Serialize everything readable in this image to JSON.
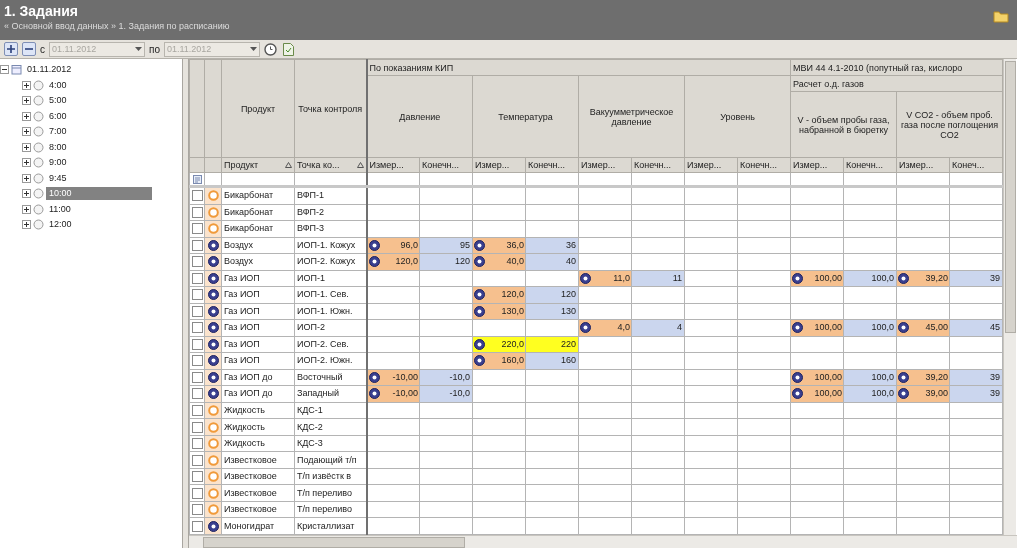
{
  "header": {
    "title": "1. Задания",
    "breadcrumb": "« Основной ввод данных » 1. Задания по расписанию"
  },
  "toolbar": {
    "from_label": "с",
    "from_date": "01.11.2012",
    "to_label": "по",
    "to_date": "01.11.2012",
    "disabled": true
  },
  "tree": [
    {
      "label": "01.11.2012",
      "expanded": true,
      "selected": false,
      "children": [
        {
          "label": "4:00",
          "expanded": false,
          "selected": false
        },
        {
          "label": "5:00",
          "expanded": false,
          "selected": false
        },
        {
          "label": "6:00",
          "expanded": false,
          "selected": false
        },
        {
          "label": "7:00",
          "expanded": false,
          "selected": false
        },
        {
          "label": "8:00",
          "expanded": false,
          "selected": false
        },
        {
          "label": "9:00",
          "expanded": false,
          "selected": false
        },
        {
          "label": "9:45",
          "expanded": false,
          "selected": false
        },
        {
          "label": "10:00",
          "expanded": false,
          "selected": true
        },
        {
          "label": "11:00",
          "expanded": false,
          "selected": false
        },
        {
          "label": "12:00",
          "expanded": false,
          "selected": false
        }
      ]
    }
  ],
  "grid": {
    "fixed_columns": [
      {
        "header": "Продукт",
        "sub": "Продукт",
        "sorted": true
      },
      {
        "header": "Точка контроля",
        "sub": "Точка ко...",
        "sorted": true
      }
    ],
    "sections": [
      {
        "label": "По показаниям КИП",
        "groups": [
          {
            "header": "Давление",
            "columns": [
              "Измер...",
              "Конечн..."
            ]
          },
          {
            "header": "Температура",
            "columns": [
              "Измер...",
              "Конечн..."
            ]
          },
          {
            "header": "Вакуумметрическое давление",
            "columns": [
              "Измер...",
              "Конечн..."
            ]
          },
          {
            "header": "Уровень",
            "columns": [
              "Измер...",
              "Конечн..."
            ]
          }
        ]
      },
      {
        "label": "МВИ 44 4.1-2010 (попутный газ, кислоро",
        "subtitle": "Расчет о.д. газов",
        "groups": [
          {
            "header": "V - объем пробы газа, набранной в бюретку",
            "columns": [
              "Измер...",
              "Конечн..."
            ]
          },
          {
            "header": "V CO2 - объем проб. газа после поглощения CO2",
            "columns": [
              "Измер...",
              "Конеч..."
            ]
          }
        ]
      }
    ],
    "rows": [
      {
        "checked": false,
        "kind": "pending",
        "product": "Бикарбонат",
        "point": "ВФП-1"
      },
      {
        "checked": false,
        "kind": "pending",
        "product": "Бикарбонат",
        "point": "ВФП-2"
      },
      {
        "checked": false,
        "kind": "pending",
        "product": "Бикарбонат",
        "point": "ВФП-3"
      },
      {
        "checked": false,
        "kind": "measured",
        "product": "Воздух",
        "point": "ИОП-1. Кожух",
        "pressure": {
          "measured": "96,0",
          "final": "95",
          "highlighted": false
        },
        "temperature": {
          "measured": "36,0",
          "final": "36",
          "highlighted": false
        }
      },
      {
        "checked": false,
        "kind": "measured",
        "product": "Воздух",
        "point": "ИОП-2. Кожух",
        "pressure": {
          "measured": "120,0",
          "final": "120",
          "highlighted": false
        },
        "temperature": {
          "measured": "40,0",
          "final": "40",
          "highlighted": false
        }
      },
      {
        "checked": false,
        "kind": "measured",
        "product": "Газ ИОП",
        "point": "ИОП-1",
        "vacuum_pressure": {
          "measured": "11,0",
          "final": "11",
          "highlighted": false
        },
        "sample_volume": {
          "measured": "100,00",
          "final": "100,0",
          "highlighted": false
        },
        "co2_volume": {
          "measured": "39,20",
          "final": "39",
          "highlighted": false
        }
      },
      {
        "checked": false,
        "kind": "measured",
        "product": "Газ ИОП",
        "point": "ИОП-1. Сев.",
        "temperature": {
          "measured": "120,0",
          "final": "120",
          "highlighted": false
        }
      },
      {
        "checked": false,
        "kind": "measured",
        "product": "Газ ИОП",
        "point": "ИОП-1. Южн.",
        "temperature": {
          "measured": "130,0",
          "final": "130",
          "highlighted": false
        }
      },
      {
        "checked": false,
        "kind": "measured",
        "product": "Газ ИОП",
        "point": "ИОП-2",
        "vacuum_pressure": {
          "measured": "4,0",
          "final": "4",
          "highlighted": false
        },
        "sample_volume": {
          "measured": "100,00",
          "final": "100,0",
          "highlighted": false
        },
        "co2_volume": {
          "measured": "45,00",
          "final": "45",
          "highlighted": false
        }
      },
      {
        "checked": false,
        "kind": "measured",
        "product": "Газ ИОП",
        "point": "ИОП-2. Сев.",
        "temperature": {
          "measured": "220,0",
          "final": "220",
          "highlighted": true
        }
      },
      {
        "checked": false,
        "kind": "measured",
        "product": "Газ ИОП",
        "point": "ИОП-2. Южн.",
        "temperature": {
          "measured": "160,0",
          "final": "160",
          "highlighted": false
        }
      },
      {
        "checked": false,
        "kind": "measured",
        "product": "Газ ИОП до",
        "point": "Восточный",
        "pressure": {
          "measured": "-10,00",
          "final": "-10,0",
          "highlighted": false
        },
        "sample_volume": {
          "measured": "100,00",
          "final": "100,0",
          "highlighted": false
        },
        "co2_volume": {
          "measured": "39,20",
          "final": "39",
          "highlighted": false
        }
      },
      {
        "checked": false,
        "kind": "measured",
        "product": "Газ ИОП до",
        "point": "Западный",
        "pressure": {
          "measured": "-10,00",
          "final": "-10,0",
          "highlighted": false
        },
        "sample_volume": {
          "measured": "100,00",
          "final": "100,0",
          "highlighted": false
        },
        "co2_volume": {
          "measured": "39,00",
          "final": "39",
          "highlighted": false
        }
      },
      {
        "checked": false,
        "kind": "pending",
        "product": "Жидкость",
        "point": "КДС-1"
      },
      {
        "checked": false,
        "kind": "pending",
        "product": "Жидкость",
        "point": "КДС-2"
      },
      {
        "checked": false,
        "kind": "pending",
        "product": "Жидкость",
        "point": "КДС-3"
      },
      {
        "checked": false,
        "kind": "pending",
        "product": "Известковое",
        "point": "Подающий т/п"
      },
      {
        "checked": false,
        "kind": "pending",
        "product": "Известковое",
        "point": "Т/п извёстк в"
      },
      {
        "checked": false,
        "kind": "pending",
        "product": "Известковое",
        "point": "Т/п переливо"
      },
      {
        "checked": false,
        "kind": "pending",
        "product": "Известковое",
        "point": "Т/п переливо"
      },
      {
        "checked": false,
        "kind": "measured",
        "product": "Моногидрат",
        "point": "Кристаллизат"
      }
    ]
  }
}
